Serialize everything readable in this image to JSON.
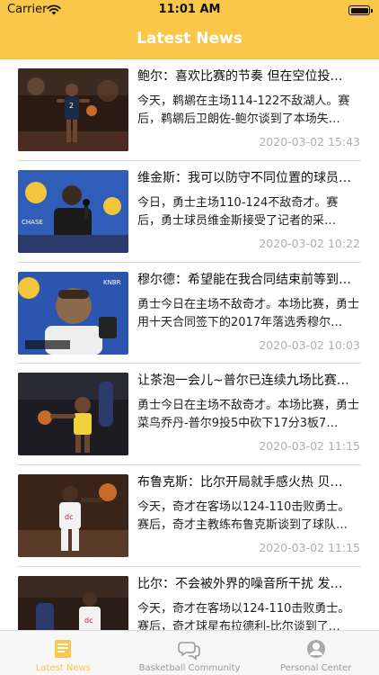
{
  "status_bar": {
    "carrier": "Carrier",
    "time": "11:01 AM"
  },
  "nav": {
    "title": "Latest News"
  },
  "news": [
    {
      "headline": "鲍尔：喜欢比赛的节奏 但在空位投…",
      "summary": "今天，鹈鹕在主场114-122不敌湖人。赛后，鹈鹕后卫朗佐-鲍尔谈到了本场失…",
      "date": "2020-03-02 15:43"
    },
    {
      "headline": "维金斯：我可以防守不同位置的球员…",
      "summary": "  今日，勇士主场110-124不敌奇才。赛后，勇士球员维金斯接受了记者的采…",
      "date": "2020-03-02 10:22"
    },
    {
      "headline": "穆尔德：希望能在我合同结束前等到…",
      "summary": "勇士今日在主场不敌奇才。本场比赛，勇士用十天合同签下的2017年落选秀穆尔…",
      "date": "2020-03-02 10:03"
    },
    {
      "headline": "让茶泡一会儿~普尔已连续九场比赛…",
      "summary": "勇士今日在主场不敌奇才。本场比赛，勇士菜鸟乔丹-普尔9投5中砍下17分3板7…",
      "date": "2020-03-02 11:15"
    },
    {
      "headline": "布鲁克斯：比尔开局就手感火热 贝…",
      "summary": "今天，奇才在客场以124-110击败勇士。赛后，奇才主教练布鲁克斯谈到了球队…",
      "date": "2020-03-02 11:15"
    },
    {
      "headline": "比尔：不会被外界的噪音所干扰 发…",
      "summary": "今天，奇才在客场以124-110击败勇士。赛后，奇才球星布拉德利-比尔谈到了…",
      "date": ""
    }
  ],
  "tabs": [
    {
      "label": "Latest News",
      "icon": "news-icon",
      "active": true
    },
    {
      "label": "Basketball Community",
      "icon": "chat-bubbles-icon",
      "active": false
    },
    {
      "label": "Personal Center",
      "icon": "person-icon",
      "active": false
    }
  ],
  "colors": {
    "accent": "#f9c84a",
    "date": "#b0b0b0",
    "tab_inactive": "#999999"
  }
}
